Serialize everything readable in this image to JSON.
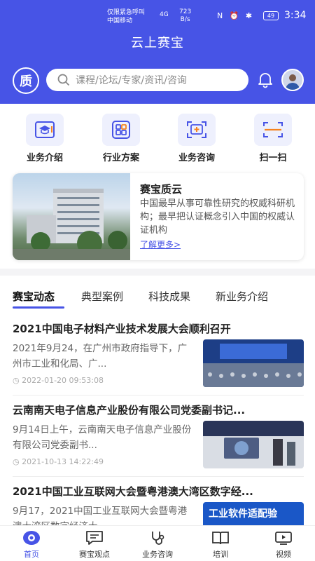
{
  "status_bar": {
    "carrier_line1": "仅限紧急呼叫",
    "carrier_line2": "中国移动",
    "signal": "4G",
    "speed_value": "723",
    "speed_unit": "B/s",
    "battery": "49",
    "time": "3:34"
  },
  "header": {
    "title": "云上赛宝",
    "search_placeholder": "课程/论坛/专家/资讯/咨询",
    "logo_text": "质"
  },
  "quick_actions": [
    {
      "label": "业务介绍",
      "icon": "graduation-cap-icon"
    },
    {
      "label": "行业方案",
      "icon": "grid-icon"
    },
    {
      "label": "业务咨询",
      "icon": "consult-icon"
    },
    {
      "label": "扫一扫",
      "icon": "scan-icon"
    }
  ],
  "intro_card": {
    "title": "赛宝质云",
    "description": "中国最早从事可靠性研究的权威科研机构；最早把认证概念引入中国的权威认证机构",
    "more": "了解更多>"
  },
  "tabs": [
    "赛宝动态",
    "典型案例",
    "科技成果",
    "新业务介绍"
  ],
  "news": [
    {
      "title": "2021中国电子材料产业技术发展大会顺利召开",
      "body": "2021年9月24，在广州市政府指导下，广州市工业和化局、广...",
      "time": "2022-01-20 09:53:08"
    },
    {
      "title": "云南南天电子信息产业股份有限公司党委副书记...",
      "body": "9月14日上午，云南南天电子信息产业股份有限公司党委副书...",
      "time": "2021-10-13 14:22:49"
    },
    {
      "title": "2021中国工业互联网大会暨粤港澳大湾区数字经...",
      "body": "9月17，2021中国工业互联网大会暨粤港澳大湾区数字经济大",
      "time": "",
      "image_text": "工业软件适配验"
    }
  ],
  "bottom_nav": [
    {
      "label": "首页",
      "icon": "home-eye-icon",
      "active": true
    },
    {
      "label": "赛宝观点",
      "icon": "chat-icon",
      "active": false
    },
    {
      "label": "业务咨询",
      "icon": "stethoscope-icon",
      "active": false
    },
    {
      "label": "培训",
      "icon": "book-icon",
      "active": false
    },
    {
      "label": "视频",
      "icon": "video-icon",
      "active": false
    }
  ],
  "colors": {
    "primary": "#4754e6",
    "text": "#222222",
    "muted": "#aaaaaa"
  }
}
